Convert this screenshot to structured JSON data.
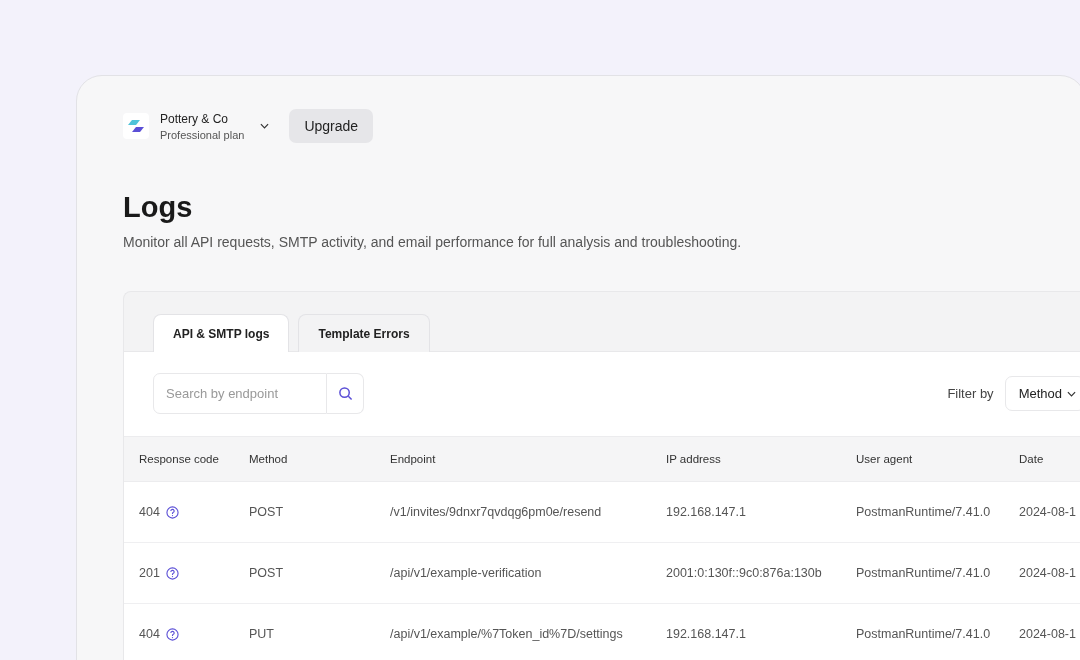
{
  "workspace": {
    "name": "Pottery & Co",
    "plan": "Professional plan"
  },
  "upgrade_button": "Upgrade",
  "page": {
    "title": "Logs",
    "description": "Monitor all API requests, SMTP activity, and email performance for full analysis and troubleshooting."
  },
  "tabs": [
    {
      "label": "API & SMTP logs",
      "selected": true
    },
    {
      "label": "Template Errors",
      "selected": false
    }
  ],
  "search": {
    "placeholder": "Search by endpoint"
  },
  "filter": {
    "label": "Filter by",
    "value": "Method"
  },
  "table": {
    "columns": [
      "Response code",
      "Method",
      "Endpoint",
      "IP address",
      "User agent",
      "Date"
    ],
    "rows": [
      {
        "code": "404",
        "method": "POST",
        "endpoint": "/v1/invites/9dnxr7qvdqg6pm0e/resend",
        "ip": "192.168.147.1",
        "agent": "PostmanRuntime/7.41.0",
        "date": "2024-08-1"
      },
      {
        "code": "201",
        "method": "POST",
        "endpoint": "/api/v1/example-verification",
        "ip": "2001:0:130f::9c0:876a:130b",
        "agent": "PostmanRuntime/7.41.0",
        "date": "2024-08-1"
      },
      {
        "code": "404",
        "method": "PUT",
        "endpoint": "/api/v1/example/%7Token_id%7D/settings",
        "ip": "192.168.147.1",
        "agent": "PostmanRuntime/7.41.0",
        "date": "2024-08-1"
      }
    ]
  }
}
